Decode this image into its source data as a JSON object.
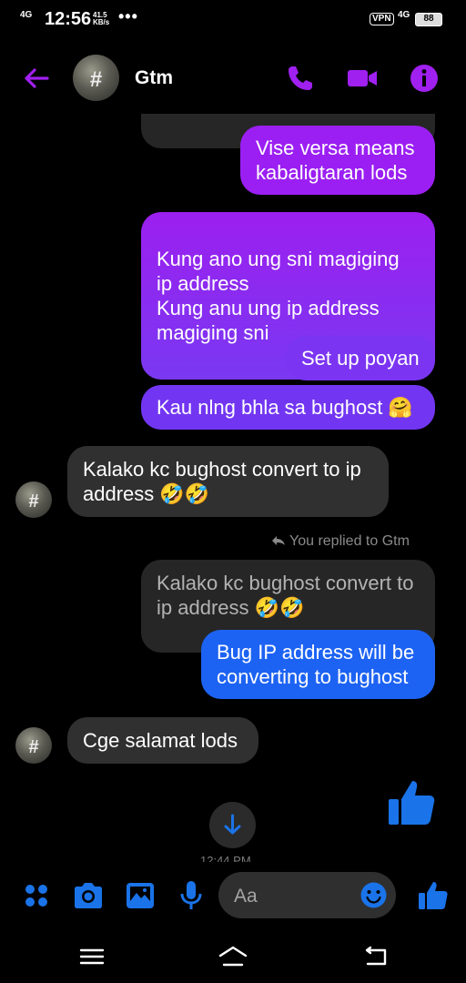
{
  "status_bar": {
    "network_left": "4G",
    "time": "12:56",
    "speed_value": "41.5",
    "speed_unit": "KB/s",
    "more_dots": "•••",
    "vpn": "VPN",
    "network_right": "4G",
    "battery": "88"
  },
  "header": {
    "contact_name": "Gtm",
    "avatar_glyph": "#"
  },
  "messages": [
    {
      "id": "m1",
      "text": "Vise versa means kabaligtaran lods"
    },
    {
      "id": "m2",
      "text": "Kung ano ung sni magiging ip address\nKung anu ung ip address magiging sni"
    },
    {
      "id": "m3",
      "text": "Set up poyan"
    },
    {
      "id": "m4",
      "text": "Kau nlng bhla sa bughost 🤗"
    },
    {
      "id": "m5",
      "text": "Kalako kc bughost  convert to ip address 🤣🤣"
    },
    {
      "id": "m6",
      "text": "Kalako kc bughost  convert to ip address 🤣🤣"
    },
    {
      "id": "m7",
      "text": "Bug IP address will be converting to bughost"
    },
    {
      "id": "m8",
      "text": "Cge salamat lods"
    }
  ],
  "reply_label": "You replied to Gtm",
  "timestamp_partial": "12:44 PM",
  "composer": {
    "placeholder": "Aa"
  },
  "colors": {
    "accent": "#9b1ff2",
    "blue_bubble": "#1d63f3",
    "icon_blue": "#1a73e8",
    "header_purple": "#a020f0"
  },
  "icons": {
    "back": "arrow-left-icon",
    "call": "phone-icon",
    "video": "video-camera-icon",
    "info": "info-icon",
    "like": "thumbs-up-icon",
    "scroll_down": "arrow-down-icon",
    "apps": "four-dots-icon",
    "camera": "camera-icon",
    "gallery": "image-icon",
    "mic": "microphone-icon",
    "emoji": "smiley-icon"
  }
}
